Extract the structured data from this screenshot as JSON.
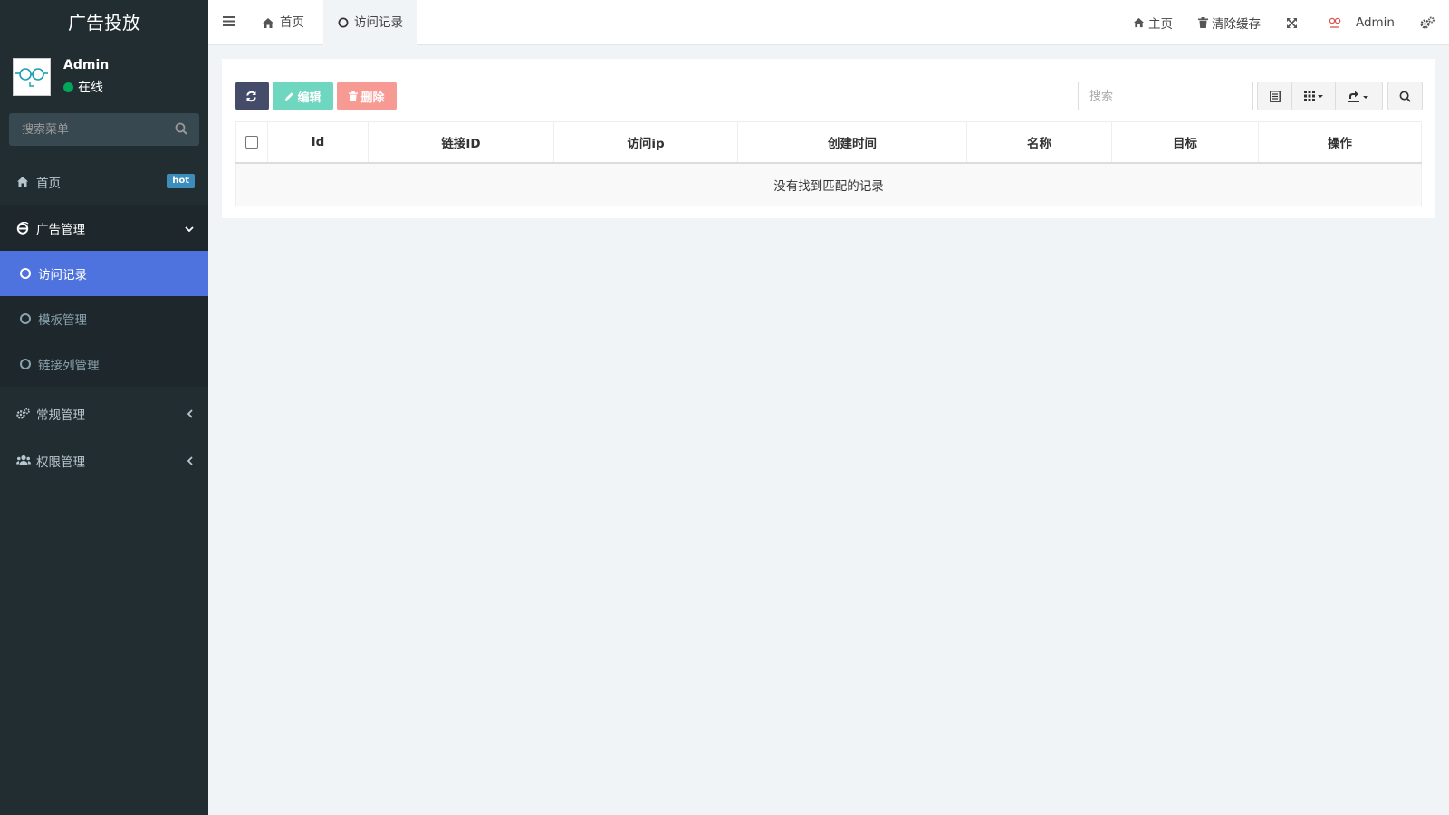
{
  "sidebar": {
    "brand": "广告投放",
    "user": {
      "name": "Admin",
      "status": "在线"
    },
    "search": {
      "placeholder": "搜索菜单"
    },
    "menu": [
      {
        "label": "首页",
        "icon": "home-icon",
        "badge": "hot"
      },
      {
        "label": "广告管理",
        "icon": "ie-icon",
        "open": true,
        "children": [
          {
            "label": "访问记录",
            "active": true
          },
          {
            "label": "模板管理"
          },
          {
            "label": "链接列管理"
          }
        ]
      },
      {
        "label": "常规管理",
        "icon": "gears-icon"
      },
      {
        "label": "权限管理",
        "icon": "users-icon"
      }
    ]
  },
  "topbar": {
    "tabs": [
      {
        "label": "首页",
        "icon": "home-icon"
      },
      {
        "label": "访问记录",
        "icon": "circle-icon",
        "active": true
      }
    ],
    "right": {
      "home": "主页",
      "clear_cache": "清除缓存",
      "admin": "Admin"
    }
  },
  "toolbar": {
    "edit": "编辑",
    "delete": "删除",
    "search_placeholder": "搜索"
  },
  "table": {
    "columns": [
      "Id",
      "链接ID",
      "访问ip",
      "创建时间",
      "名称",
      "目标",
      "操作"
    ],
    "empty_text": "没有找到匹配的记录"
  },
  "colors": {
    "sidebar_bg": "#222d32",
    "active_item": "#4e73df",
    "refresh_btn": "#444c69",
    "edit_btn": "#6fd6c0",
    "delete_btn": "#f79a94",
    "online": "#00a65a",
    "hot_badge": "#3c8dbc"
  }
}
